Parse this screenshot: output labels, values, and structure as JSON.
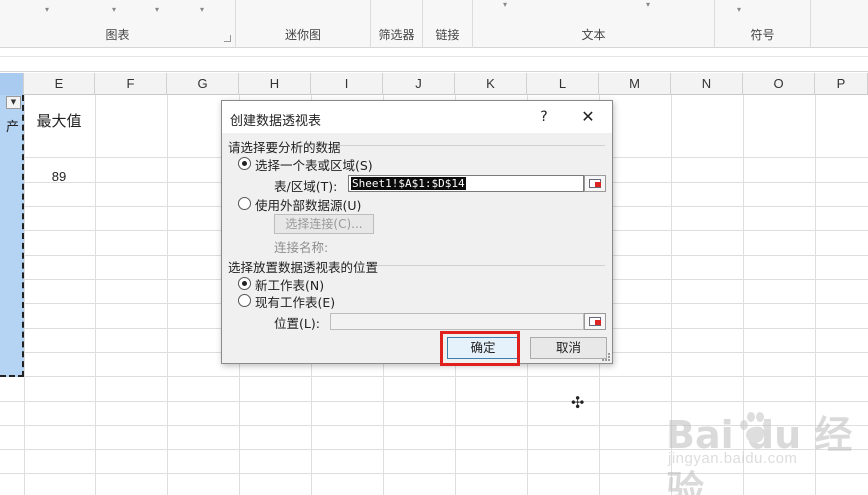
{
  "ribbon": {
    "groups": [
      {
        "id": "charts",
        "label": "图表"
      },
      {
        "id": "sparklines",
        "label": "迷你图"
      },
      {
        "id": "filters",
        "label": "筛选器"
      },
      {
        "id": "links",
        "label": "链接"
      },
      {
        "id": "text",
        "label": "文本"
      },
      {
        "id": "symbols",
        "label": "符号"
      }
    ]
  },
  "sheet": {
    "columns": [
      "E",
      "F",
      "G",
      "H",
      "I",
      "J",
      "K",
      "L",
      "M",
      "N",
      "O",
      "P"
    ],
    "selected_column": "E",
    "selected_range_char": "产",
    "cells": {
      "max_label": "最大值",
      "max_value": "89"
    }
  },
  "dialog": {
    "title": "创建数据透视表",
    "help": "?",
    "close": "✕",
    "section1_title": "请选择要分析的数据",
    "option_select_range": "选择一个表或区域(S)",
    "range_label": "表/区域(T):",
    "range_value": "Sheet1!$A$1:$D$14",
    "option_external": "使用外部数据源(U)",
    "choose_connection": "选择连接(C)...",
    "connection_name_label": "连接名称:",
    "section2_title": "选择放置数据透视表的位置",
    "option_new_sheet": "新工作表(N)",
    "option_existing_sheet": "现有工作表(E)",
    "location_label": "位置(L):",
    "location_value": "",
    "ok": "确定",
    "cancel": "取消"
  },
  "watermark": {
    "brand": "Bai  du 经验",
    "url": "jingyan.baidu.com"
  },
  "colors": {
    "selection_fill": "#b5d3f3",
    "ok_highlight": "#e0201c",
    "dialog_bg": "#f0f0f0"
  }
}
